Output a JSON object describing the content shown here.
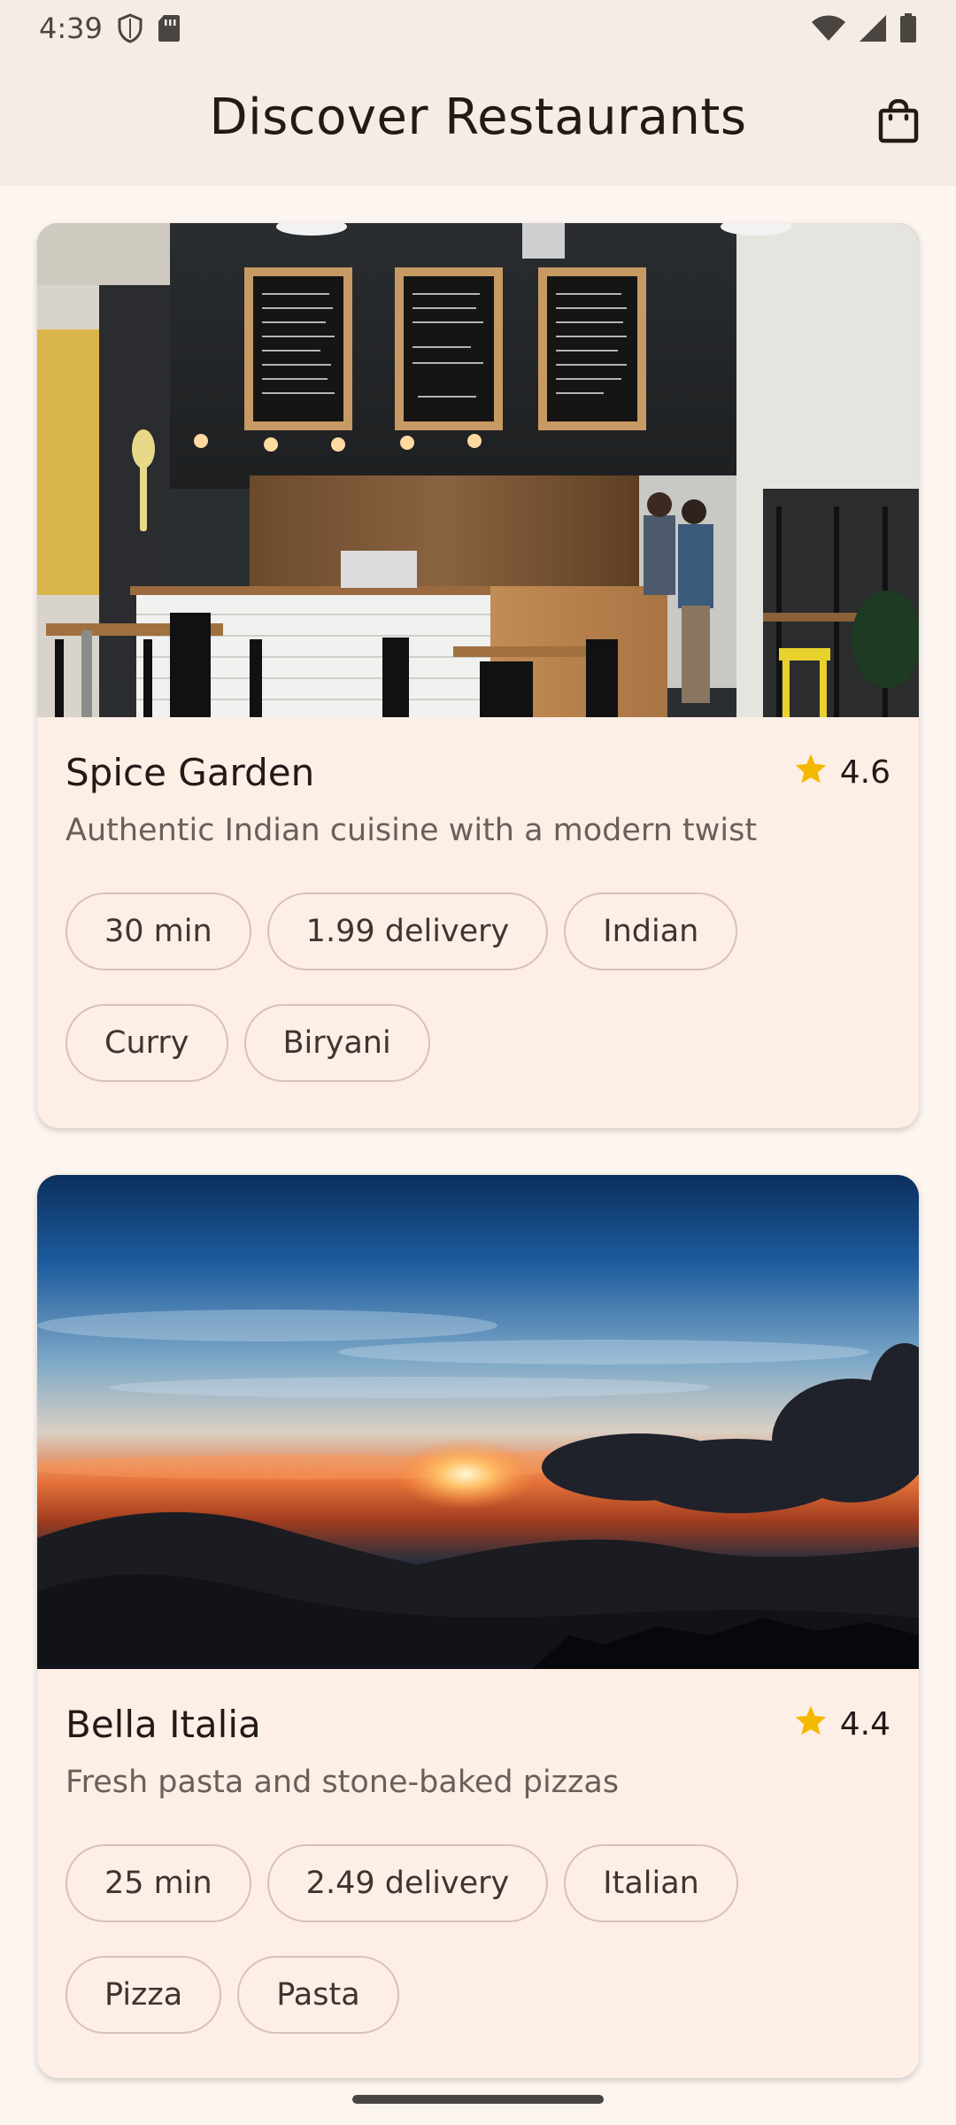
{
  "status_bar": {
    "time": "4:39",
    "icons": [
      "shield-icon",
      "sim-card-icon",
      "wifi-icon",
      "signal-icon",
      "battery-icon"
    ]
  },
  "app_bar": {
    "title": "Discover Restaurants",
    "cart_icon": "shopping-bag-icon"
  },
  "restaurants": [
    {
      "name": "Spice Garden",
      "rating": "4.6",
      "description": "Authentic Indian cuisine with a modern twist",
      "chips": [
        "30 min",
        "1.99 delivery",
        "Indian",
        "Curry",
        "Biryani"
      ],
      "image": "cafe-interior-photo"
    },
    {
      "name": "Bella Italia",
      "rating": "4.4",
      "description": "Fresh pasta and stone-baked pizzas",
      "chips": [
        "25 min",
        "2.49 delivery",
        "Italian",
        "Pizza",
        "Pasta"
      ],
      "image": "sunset-mountains-photo"
    }
  ],
  "colors": {
    "background": "#fdf5f0",
    "bar": "#f6ece6",
    "card": "#fdeee6",
    "star": "#f5b800",
    "chip_border": "#d7c2ba"
  }
}
